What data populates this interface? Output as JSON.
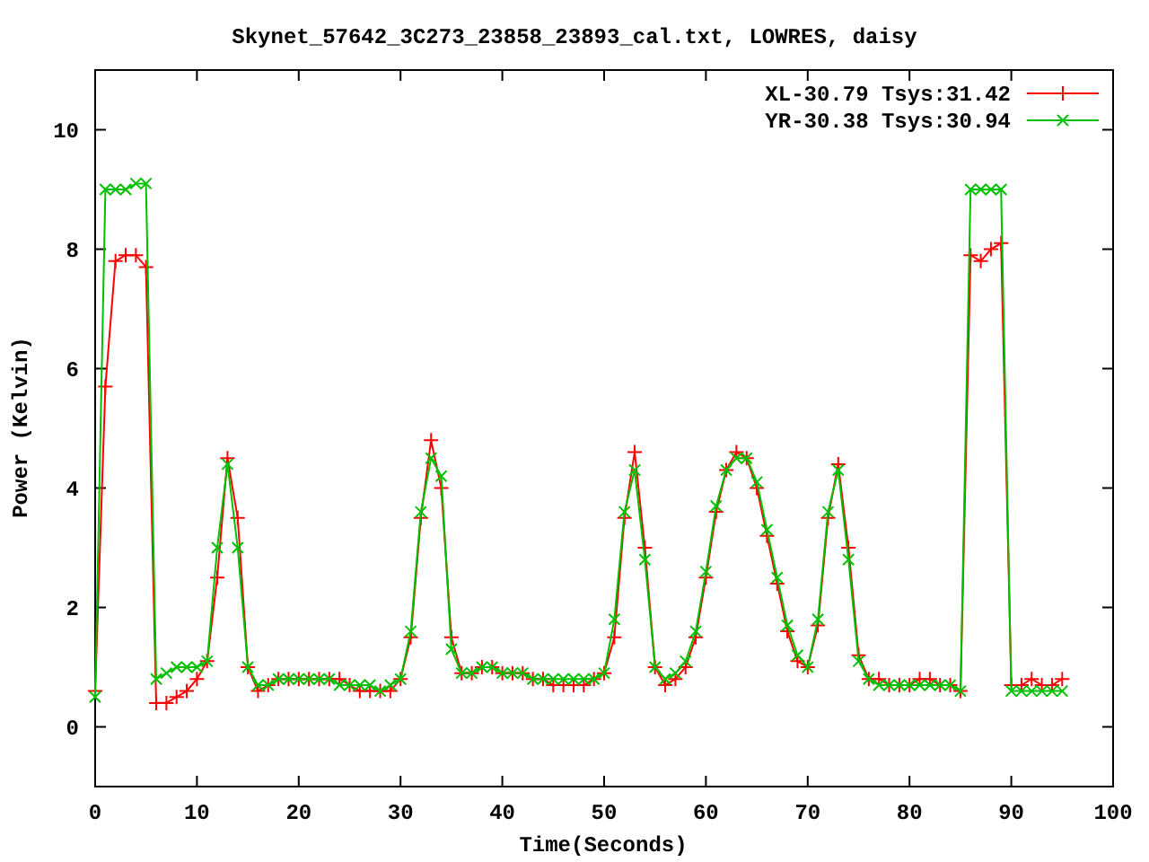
{
  "chart_data": {
    "type": "line",
    "title": "Skynet_57642_3C273_23858_23893_cal.txt, LOWRES, daisy",
    "xlabel": "Time(Seconds)",
    "ylabel": "Power (Kelvin)",
    "x": [
      0,
      1,
      2,
      3,
      4,
      5,
      6,
      7,
      8,
      9,
      10,
      11,
      12,
      13,
      14,
      15,
      16,
      17,
      18,
      19,
      20,
      21,
      22,
      23,
      24,
      25,
      26,
      27,
      28,
      29,
      30,
      31,
      32,
      33,
      34,
      35,
      36,
      37,
      38,
      39,
      40,
      41,
      42,
      43,
      44,
      45,
      46,
      47,
      48,
      49,
      50,
      51,
      52,
      53,
      54,
      55,
      56,
      57,
      58,
      59,
      60,
      61,
      62,
      63,
      64,
      65,
      66,
      67,
      68,
      69,
      70,
      71,
      72,
      73,
      74,
      75,
      76,
      77,
      78,
      79,
      80,
      81,
      82,
      83,
      84,
      85,
      86,
      87,
      88,
      89,
      90,
      91,
      92,
      93,
      94,
      95
    ],
    "series": [
      {
        "name": "XL-30.79 Tsys:31.42",
        "color": "#ff0000",
        "marker": "plus",
        "values": [
          0.6,
          5.7,
          7.8,
          7.9,
          7.9,
          7.7,
          0.4,
          0.4,
          0.5,
          0.6,
          0.8,
          1.1,
          2.5,
          4.5,
          3.5,
          1.0,
          0.6,
          0.7,
          0.8,
          0.8,
          0.8,
          0.8,
          0.8,
          0.8,
          0.8,
          0.7,
          0.6,
          0.6,
          0.6,
          0.6,
          0.8,
          1.5,
          3.5,
          4.8,
          4.0,
          1.5,
          0.9,
          0.9,
          1.0,
          1.0,
          0.9,
          0.9,
          0.9,
          0.8,
          0.8,
          0.7,
          0.7,
          0.7,
          0.7,
          0.8,
          0.9,
          1.5,
          3.5,
          4.6,
          3.0,
          1.0,
          0.7,
          0.8,
          1.0,
          1.5,
          2.5,
          3.6,
          4.3,
          4.6,
          4.5,
          4.0,
          3.2,
          2.4,
          1.6,
          1.1,
          1.0,
          1.7,
          3.5,
          4.4,
          3.0,
          1.2,
          0.8,
          0.8,
          0.7,
          0.7,
          0.7,
          0.8,
          0.8,
          0.7,
          0.7,
          0.6,
          7.9,
          7.8,
          8.0,
          8.1,
          0.7,
          0.7,
          0.8,
          0.7,
          0.7,
          0.8
        ]
      },
      {
        "name": "YR-30.38 Tsys:30.94",
        "color": "#00c000",
        "marker": "cross",
        "values": [
          0.5,
          9.0,
          9.0,
          9.0,
          9.1,
          9.1,
          0.8,
          0.9,
          1.0,
          1.0,
          1.0,
          1.1,
          3.0,
          4.4,
          3.0,
          1.0,
          0.7,
          0.7,
          0.8,
          0.8,
          0.8,
          0.8,
          0.8,
          0.8,
          0.7,
          0.7,
          0.7,
          0.7,
          0.6,
          0.7,
          0.8,
          1.6,
          3.6,
          4.5,
          4.2,
          1.3,
          0.9,
          0.9,
          1.0,
          1.0,
          0.9,
          0.9,
          0.9,
          0.8,
          0.8,
          0.8,
          0.8,
          0.8,
          0.8,
          0.8,
          0.9,
          1.8,
          3.6,
          4.3,
          2.8,
          1.0,
          0.8,
          0.9,
          1.1,
          1.6,
          2.6,
          3.7,
          4.3,
          4.5,
          4.5,
          4.1,
          3.3,
          2.5,
          1.7,
          1.2,
          1.0,
          1.8,
          3.6,
          4.3,
          2.8,
          1.1,
          0.8,
          0.7,
          0.7,
          0.7,
          0.7,
          0.7,
          0.7,
          0.7,
          0.7,
          0.6,
          9.0,
          9.0,
          9.0,
          9.0,
          0.6,
          0.6,
          0.6,
          0.6,
          0.6,
          0.6
        ]
      }
    ],
    "legend": true,
    "xlim": [
      0,
      100
    ],
    "ylim": [
      -1,
      11
    ],
    "xticks": [
      0,
      10,
      20,
      30,
      40,
      50,
      60,
      70,
      80,
      90,
      100
    ],
    "yticks": [
      0,
      2,
      4,
      6,
      8,
      10
    ]
  }
}
